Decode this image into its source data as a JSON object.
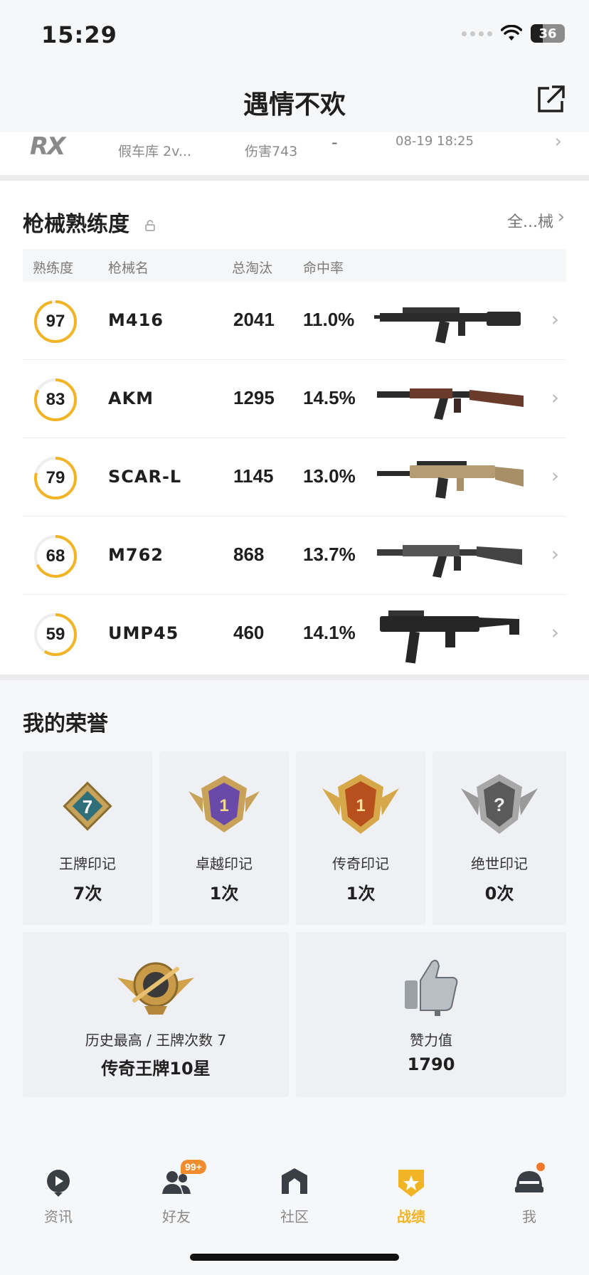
{
  "status": {
    "time": "15:29",
    "battery": "36"
  },
  "header": {
    "title": "遇情不欢"
  },
  "recent_match": {
    "mode": "假车库 2v...",
    "damage": "伤害743",
    "rank": "-",
    "datetime": "08-19 18:25"
  },
  "weapons": {
    "title": "枪械熟练度",
    "all_link": "全...械",
    "columns": [
      "熟练度",
      "枪械名",
      "总淘汰",
      "命中率"
    ],
    "rows": [
      {
        "proficiency": "97",
        "proficiency_fraction": 0.97,
        "name": "M416",
        "kills": "2041",
        "accuracy": "11.0%"
      },
      {
        "proficiency": "83",
        "proficiency_fraction": 0.83,
        "name": "AKM",
        "kills": "1295",
        "accuracy": "14.5%"
      },
      {
        "proficiency": "79",
        "proficiency_fraction": 0.79,
        "name": "SCAR-L",
        "kills": "1145",
        "accuracy": "13.0%"
      },
      {
        "proficiency": "68",
        "proficiency_fraction": 0.68,
        "name": "M762",
        "kills": "868",
        "accuracy": "13.7%"
      },
      {
        "proficiency": "59",
        "proficiency_fraction": 0.59,
        "name": "UMP45",
        "kills": "460",
        "accuracy": "14.1%"
      }
    ]
  },
  "honors": {
    "title": "我的荣誉",
    "marks": [
      {
        "label": "王牌印记",
        "value": "7次",
        "badge_text": "7"
      },
      {
        "label": "卓越印记",
        "value": "1次",
        "badge_text": "1"
      },
      {
        "label": "传奇印记",
        "value": "1次",
        "badge_text": "1"
      },
      {
        "label": "绝世印记",
        "value": "0次",
        "badge_text": "?"
      }
    ],
    "highest": {
      "label": "历史最高 / 王牌次数 7",
      "value": "传奇王牌10星"
    },
    "likes": {
      "label": "赞力值",
      "value": "1790"
    }
  },
  "tabbar": {
    "tabs": [
      {
        "label": "资讯",
        "icon": "news-icon"
      },
      {
        "label": "好友",
        "icon": "friends-icon",
        "badge": "99+"
      },
      {
        "label": "社区",
        "icon": "community-icon"
      },
      {
        "label": "战绩",
        "icon": "record-icon",
        "active": true
      },
      {
        "label": "我",
        "icon": "profile-icon"
      }
    ]
  },
  "colors": {
    "accent": "#f0b424",
    "ring_track": "#eeeeee",
    "badge_orange": "#f08c2e"
  }
}
